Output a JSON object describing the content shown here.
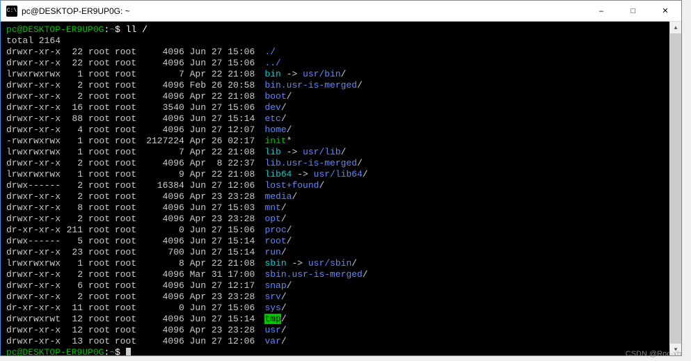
{
  "window": {
    "icon_text": "C:\\",
    "title": "pc@DESKTOP-ER9UP0G: ~"
  },
  "prompt": {
    "user_host": "pc@DESKTOP-ER9UP0G",
    "path": "~",
    "symbol": "$"
  },
  "command": "ll /",
  "total_line": "total 2164",
  "listing": [
    {
      "perms": "drwxr-xr-x",
      "links": "22",
      "owner": "root",
      "group": "root",
      "size": "4096",
      "date": "Jun 27 15:06",
      "name": "./",
      "type": "dir"
    },
    {
      "perms": "drwxr-xr-x",
      "links": "22",
      "owner": "root",
      "group": "root",
      "size": "4096",
      "date": "Jun 27 15:06",
      "name": "../",
      "type": "dir"
    },
    {
      "perms": "lrwxrwxrwx",
      "links": "1",
      "owner": "root",
      "group": "root",
      "size": "7",
      "date": "Apr 22 21:08",
      "name": "bin",
      "type": "link",
      "arrow": " -> ",
      "target": "usr/bin",
      "tail": "/"
    },
    {
      "perms": "drwxr-xr-x",
      "links": "2",
      "owner": "root",
      "group": "root",
      "size": "4096",
      "date": "Feb 26 20:58",
      "name": "bin.usr-is-merged",
      "type": "dir",
      "tail": "/"
    },
    {
      "perms": "drwxr-xr-x",
      "links": "2",
      "owner": "root",
      "group": "root",
      "size": "4096",
      "date": "Apr 22 21:08",
      "name": "boot",
      "type": "dir",
      "tail": "/"
    },
    {
      "perms": "drwxr-xr-x",
      "links": "16",
      "owner": "root",
      "group": "root",
      "size": "3540",
      "date": "Jun 27 15:06",
      "name": "dev",
      "type": "dir",
      "tail": "/"
    },
    {
      "perms": "drwxr-xr-x",
      "links": "88",
      "owner": "root",
      "group": "root",
      "size": "4096",
      "date": "Jun 27 15:14",
      "name": "etc",
      "type": "dir",
      "tail": "/"
    },
    {
      "perms": "drwxr-xr-x",
      "links": "4",
      "owner": "root",
      "group": "root",
      "size": "4096",
      "date": "Jun 27 12:07",
      "name": "home",
      "type": "dir",
      "tail": "/"
    },
    {
      "perms": "-rwxrwxrwx",
      "links": "1",
      "owner": "root",
      "group": "root",
      "size": "2127224",
      "date": "Apr 26 02:17",
      "name": "init",
      "type": "exec",
      "tail": "*"
    },
    {
      "perms": "lrwxrwxrwx",
      "links": "1",
      "owner": "root",
      "group": "root",
      "size": "7",
      "date": "Apr 22 21:08",
      "name": "lib",
      "type": "link",
      "arrow": " -> ",
      "target": "usr/lib",
      "tail": "/"
    },
    {
      "perms": "drwxr-xr-x",
      "links": "2",
      "owner": "root",
      "group": "root",
      "size": "4096",
      "date": "Apr  8 22:37",
      "name": "lib.usr-is-merged",
      "type": "dir",
      "tail": "/"
    },
    {
      "perms": "lrwxrwxrwx",
      "links": "1",
      "owner": "root",
      "group": "root",
      "size": "9",
      "date": "Apr 22 21:08",
      "name": "lib64",
      "type": "link",
      "arrow": " -> ",
      "target": "usr/lib64",
      "tail": "/"
    },
    {
      "perms": "drwx------",
      "links": "2",
      "owner": "root",
      "group": "root",
      "size": "16384",
      "date": "Jun 27 12:06",
      "name": "lost+found",
      "type": "dir",
      "tail": "/"
    },
    {
      "perms": "drwxr-xr-x",
      "links": "2",
      "owner": "root",
      "group": "root",
      "size": "4096",
      "date": "Apr 23 23:28",
      "name": "media",
      "type": "dir",
      "tail": "/"
    },
    {
      "perms": "drwxr-xr-x",
      "links": "8",
      "owner": "root",
      "group": "root",
      "size": "4096",
      "date": "Jun 27 15:03",
      "name": "mnt",
      "type": "dir",
      "tail": "/"
    },
    {
      "perms": "drwxr-xr-x",
      "links": "2",
      "owner": "root",
      "group": "root",
      "size": "4096",
      "date": "Apr 23 23:28",
      "name": "opt",
      "type": "dir",
      "tail": "/"
    },
    {
      "perms": "dr-xr-xr-x",
      "links": "211",
      "owner": "root",
      "group": "root",
      "size": "0",
      "date": "Jun 27 15:06",
      "name": "proc",
      "type": "dir",
      "tail": "/"
    },
    {
      "perms": "drwx------",
      "links": "5",
      "owner": "root",
      "group": "root",
      "size": "4096",
      "date": "Jun 27 15:14",
      "name": "root",
      "type": "dir",
      "tail": "/"
    },
    {
      "perms": "drwxr-xr-x",
      "links": "23",
      "owner": "root",
      "group": "root",
      "size": "700",
      "date": "Jun 27 15:14",
      "name": "run",
      "type": "dir",
      "tail": "/"
    },
    {
      "perms": "lrwxrwxrwx",
      "links": "1",
      "owner": "root",
      "group": "root",
      "size": "8",
      "date": "Apr 22 21:08",
      "name": "sbin",
      "type": "link",
      "arrow": " -> ",
      "target": "usr/sbin",
      "tail": "/"
    },
    {
      "perms": "drwxr-xr-x",
      "links": "2",
      "owner": "root",
      "group": "root",
      "size": "4096",
      "date": "Mar 31 17:00",
      "name": "sbin.usr-is-merged",
      "type": "dir",
      "tail": "/"
    },
    {
      "perms": "drwxr-xr-x",
      "links": "6",
      "owner": "root",
      "group": "root",
      "size": "4096",
      "date": "Jun 27 12:17",
      "name": "snap",
      "type": "dir",
      "tail": "/"
    },
    {
      "perms": "drwxr-xr-x",
      "links": "2",
      "owner": "root",
      "group": "root",
      "size": "4096",
      "date": "Apr 23 23:28",
      "name": "srv",
      "type": "dir",
      "tail": "/"
    },
    {
      "perms": "dr-xr-xr-x",
      "links": "11",
      "owner": "root",
      "group": "root",
      "size": "0",
      "date": "Jun 27 15:06",
      "name": "sys",
      "type": "dir",
      "tail": "/"
    },
    {
      "perms": "drwxrwxrwt",
      "links": "12",
      "owner": "root",
      "group": "root",
      "size": "4096",
      "date": "Jun 27 15:14",
      "name": "tmp",
      "type": "sticky",
      "tail": "/"
    },
    {
      "perms": "drwxr-xr-x",
      "links": "12",
      "owner": "root",
      "group": "root",
      "size": "4096",
      "date": "Apr 23 23:28",
      "name": "usr",
      "type": "dir",
      "tail": "/"
    },
    {
      "perms": "drwxr-xr-x",
      "links": "13",
      "owner": "root",
      "group": "root",
      "size": "4096",
      "date": "Jun 27 12:06",
      "name": "var",
      "type": "dir",
      "tail": "/"
    }
  ],
  "watermark": "CSDN @Roc-xb"
}
